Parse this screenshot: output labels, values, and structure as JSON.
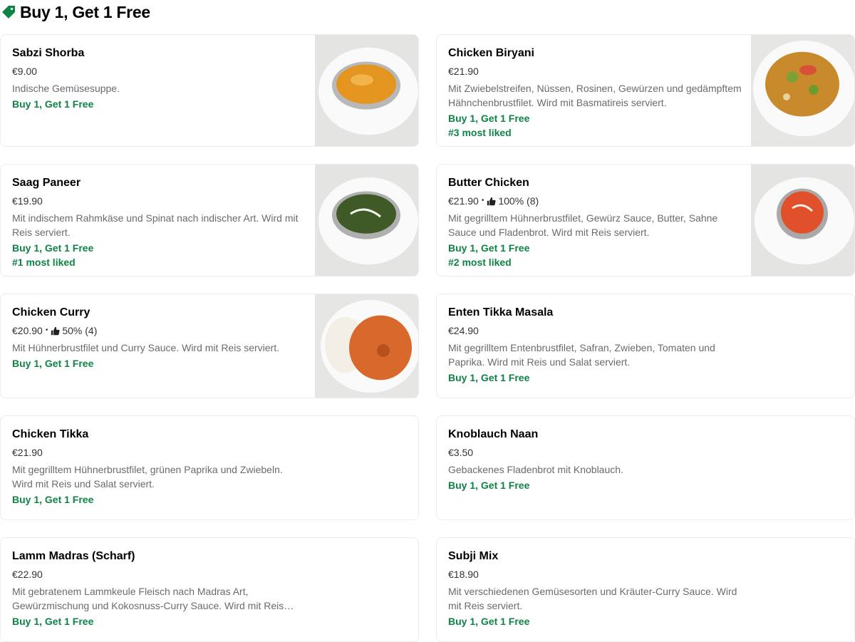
{
  "section": {
    "title": "Buy 1, Get 1 Free",
    "icon": "tag-icon",
    "accent": "#0e8345"
  },
  "items": [
    {
      "name": "Sabzi Shorba",
      "price": "€9.00",
      "description": "Indische Gemüsesuppe.",
      "promo": "Buy 1, Get 1 Free"
    },
    {
      "name": "Chicken Biryani",
      "price": "€21.90",
      "description": "Mit Zwiebelstreifen, Nüssen, Rosinen, Gewürzen und gedämpftem Hähnchenbrustfilet. Wird mit Basmatireis serviert.",
      "promo": "Buy 1, Get 1 Free",
      "liked": "#3 most liked"
    },
    {
      "name": "Saag Paneer",
      "price": "€19.90",
      "description": "Mit indischem Rahmkäse und Spinat nach indischer Art. Wird mit Reis serviert.",
      "promo": "Buy 1, Get 1 Free",
      "liked": "#1 most liked"
    },
    {
      "name": "Butter Chicken",
      "price": "€21.90",
      "rating": "100% (8)",
      "description": "Mit gegrilltem Hühnerbrustfilet, Gewürz Sauce, Butter, Sahne Sauce und Fladenbrot. Wird mit Reis serviert.",
      "promo": "Buy 1, Get 1 Free",
      "liked": "#2 most liked"
    },
    {
      "name": "Chicken Curry",
      "price": "€20.90",
      "rating": "50% (4)",
      "description": "Mit Hühnerbrustfilet und Curry Sauce. Wird mit Reis serviert.",
      "promo": "Buy 1, Get 1 Free"
    },
    {
      "name": "Enten Tikka Masala",
      "price": "€24.90",
      "description": "Mit gegrilltem Entenbrustfilet, Safran, Zwieben, Tomaten und Paprika. Wird mit Reis und Salat serviert.",
      "promo": "Buy 1, Get 1 Free"
    },
    {
      "name": "Chicken Tikka",
      "price": "€21.90",
      "description": "Mit gegrilltem Hühnerbrustfilet, grünen Paprika und Zwiebeln. Wird mit Reis und Salat serviert.",
      "promo": "Buy 1, Get 1 Free"
    },
    {
      "name": "Knoblauch Naan",
      "price": "€3.50",
      "description": "Gebackenes Fladenbrot mit Knoblauch.",
      "promo": "Buy 1, Get 1 Free"
    },
    {
      "name": "Lamm Madras (Scharf)",
      "price": "€22.90",
      "description": "Mit gebratenem Lammkeule Fleisch nach Madras Art, Gewürzmischung und Kokosnuss-Curry Sauce. Wird mit Reis serviert.",
      "promo": "Buy 1, Get 1 Free"
    },
    {
      "name": "Subji Mix",
      "price": "€18.90",
      "description": "Mit verschiedenen Gemüsesorten und Kräuter-Curry Sauce. Wird mit Reis serviert.",
      "promo": "Buy 1, Get 1 Free"
    }
  ]
}
